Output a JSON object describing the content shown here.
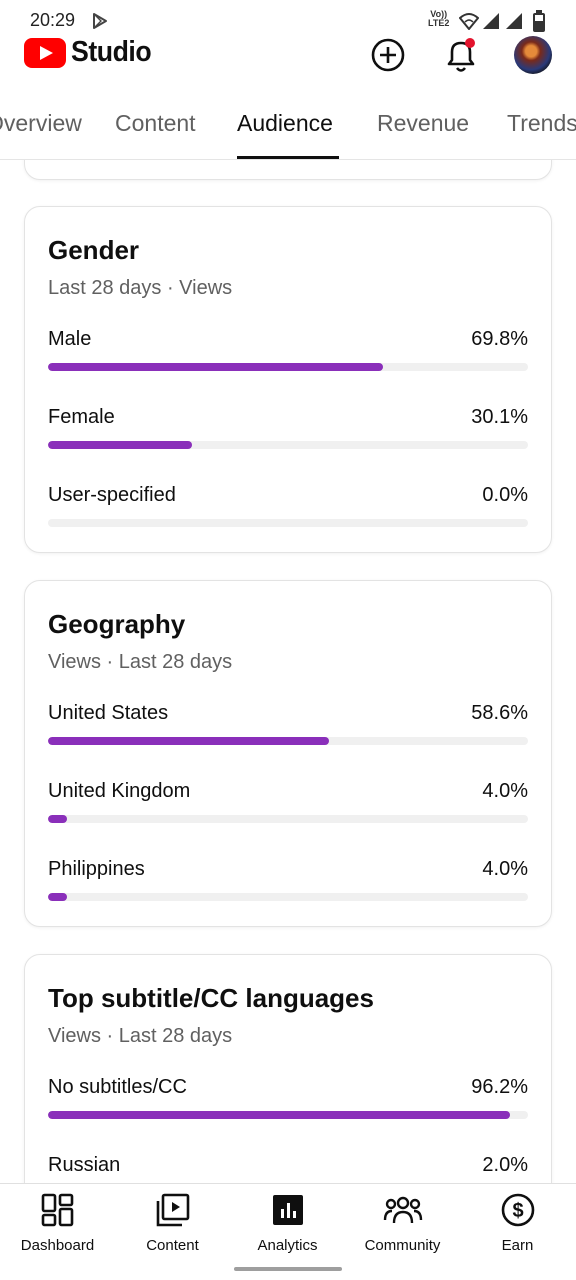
{
  "status_bar": {
    "time": "20:29",
    "volte": "Vo))\nLTE2"
  },
  "header": {
    "logo_text": "Studio"
  },
  "tabs": [
    {
      "label": "Overview"
    },
    {
      "label": "Content"
    },
    {
      "label": "Audience",
      "active": true
    },
    {
      "label": "Revenue"
    },
    {
      "label": "Trends"
    }
  ],
  "cards": {
    "gender": {
      "title": "Gender",
      "subtitle": "Last 28 days · Views",
      "rows": [
        {
          "label": "Male",
          "value": "69.8%",
          "percent": 69.8
        },
        {
          "label": "Female",
          "value": "30.1%",
          "percent": 30.1
        },
        {
          "label": "User-specified",
          "value": "0.0%",
          "percent": 0.0
        }
      ]
    },
    "geography": {
      "title": "Geography",
      "subtitle": "Views · Last 28 days",
      "rows": [
        {
          "label": "United States",
          "value": "58.6%",
          "percent": 58.6
        },
        {
          "label": "United Kingdom",
          "value": "4.0%",
          "percent": 4.0
        },
        {
          "label": "Philippines",
          "value": "4.0%",
          "percent": 4.0
        }
      ]
    },
    "subtitles": {
      "title": "Top subtitle/CC languages",
      "subtitle": "Views · Last 28 days",
      "rows": [
        {
          "label": "No subtitles/CC",
          "value": "96.2%",
          "percent": 96.2
        },
        {
          "label": "Russian",
          "value": "2.0%",
          "percent": 2.0
        }
      ]
    }
  },
  "bottom_nav": [
    {
      "label": "Dashboard",
      "icon": "dashboard-icon"
    },
    {
      "label": "Content",
      "icon": "content-icon"
    },
    {
      "label": "Analytics",
      "icon": "analytics-icon",
      "active": true
    },
    {
      "label": "Community",
      "icon": "community-icon"
    },
    {
      "label": "Earn",
      "icon": "earn-icon"
    }
  ],
  "colors": {
    "bar_fill": "#8a2fba",
    "bar_track": "#f0f0f0",
    "brand_red": "#ff0000"
  }
}
